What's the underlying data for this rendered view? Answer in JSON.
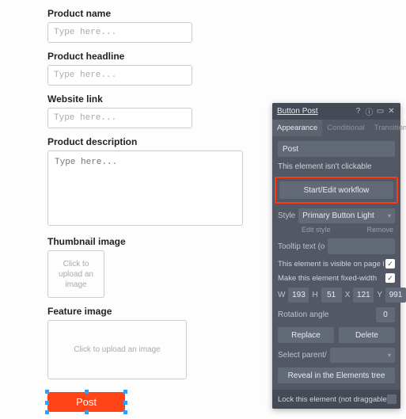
{
  "form": {
    "product_name": {
      "label": "Product name",
      "placeholder": "Type here..."
    },
    "product_headline": {
      "label": "Product headline",
      "placeholder": "Type here..."
    },
    "website_link": {
      "label": "Website link",
      "placeholder": "Type here..."
    },
    "product_description": {
      "label": "Product description",
      "placeholder": "Type here..."
    },
    "thumbnail": {
      "label": "Thumbnail image",
      "text": "Click to upload an image"
    },
    "feature": {
      "label": "Feature image",
      "text": "Click to upload an image"
    },
    "post_button": "Post"
  },
  "panel": {
    "title": "Button Post",
    "tabs": {
      "appearance": "Appearance",
      "conditional": "Conditional",
      "transitions": "Transitions"
    },
    "name_value": "Post",
    "not_clickable": "This element isn't clickable",
    "workflow_btn": "Start/Edit workflow",
    "style_label": "Style",
    "style_value": "Primary Button Light",
    "edit_style": "Edit style",
    "remove": "Remove",
    "tooltip_label": "Tooltip text (o",
    "visible_label": "This element is visible on page l",
    "fixed_width_label": "Make this element fixed-width",
    "coords": {
      "w_label": "W",
      "w": "193",
      "h_label": "H",
      "h": "51",
      "x_label": "X",
      "x": "121",
      "y_label": "Y",
      "y": "991"
    },
    "rotation_label": "Rotation angle",
    "rotation_value": "0",
    "replace": "Replace",
    "delete": "Delete",
    "select_parent": "Select parent/",
    "reveal": "Reveal in the Elements tree",
    "lock": "Lock this element (not draggable"
  }
}
